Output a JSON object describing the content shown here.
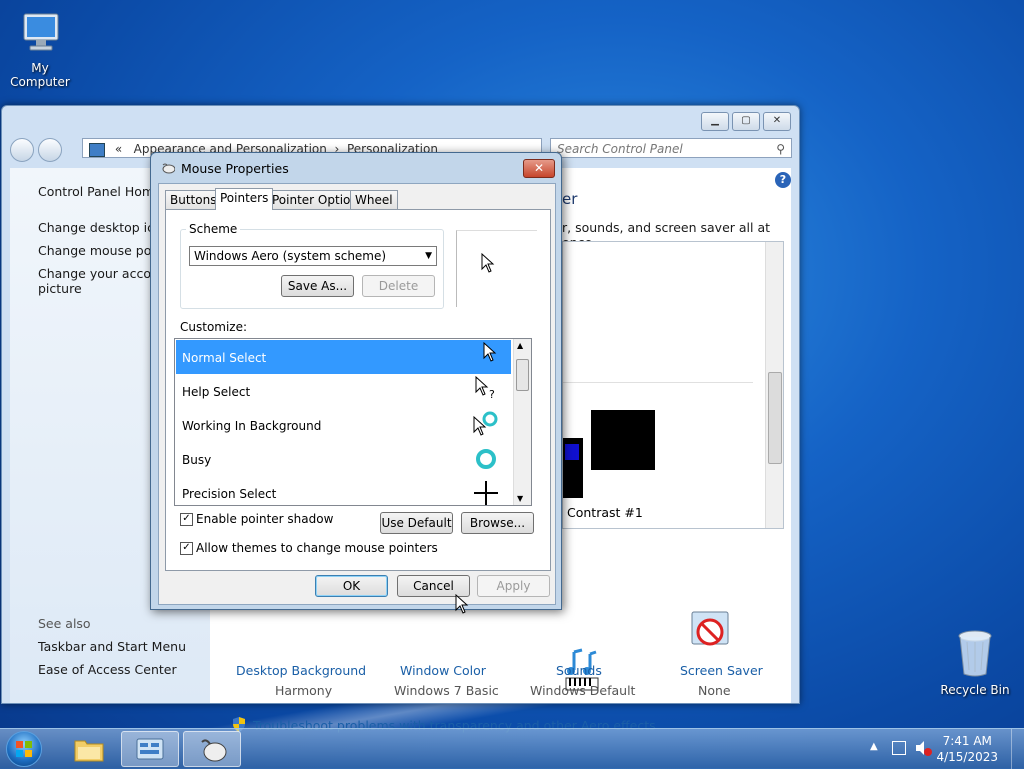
{
  "desktop": {
    "icons": [
      {
        "label": "My Computer",
        "icon": "computer-icon"
      },
      {
        "label": "Recycle Bin",
        "icon": "recycle-bin-icon"
      }
    ]
  },
  "control_panel": {
    "address": [
      "«",
      "Appearance and Personalization",
      "›",
      "Personalization"
    ],
    "search_placeholder": "Search Control Panel",
    "left_links": [
      "Control Panel Home",
      "Change desktop icons",
      "Change mouse pointers",
      "Change your account picture"
    ],
    "see_also_title": "See also",
    "see_also_links": [
      "Taskbar and Start Menu",
      "Ease of Access Center"
    ],
    "heading_fragment": "er",
    "intro_fragment": "r, sounds, and screen saver all at once.",
    "theme_label": "Contrast #1",
    "bottom_items": [
      {
        "title": "Desktop Background",
        "value": "Harmony"
      },
      {
        "title": "Window Color",
        "value": "Windows 7 Basic"
      },
      {
        "title": "Sounds",
        "value": "Windows Default"
      },
      {
        "title": "Screen Saver",
        "value": "None"
      }
    ],
    "troubleshoot_link": "Troubleshoot problems with transparency and other Aero effects"
  },
  "mouse_properties": {
    "title": "Mouse Properties",
    "tabs": [
      "Buttons",
      "Pointers",
      "Pointer Options",
      "Wheel"
    ],
    "active_tab": "Pointers",
    "scheme_label": "Scheme",
    "scheme_value": "Windows Aero (system scheme)",
    "save_as": "Save As...",
    "delete": "Delete",
    "customize_label": "Customize:",
    "list": [
      "Normal Select",
      "Help Select",
      "Working In Background",
      "Busy",
      "Precision Select"
    ],
    "enable_shadow": "Enable pointer shadow",
    "allow_themes": "Allow themes to change mouse pointers",
    "use_default": "Use Default",
    "browse": "Browse...",
    "ok": "OK",
    "cancel": "Cancel",
    "apply": "Apply"
  },
  "taskbar": {
    "time": "7:41 AM",
    "date": "4/15/2023"
  }
}
